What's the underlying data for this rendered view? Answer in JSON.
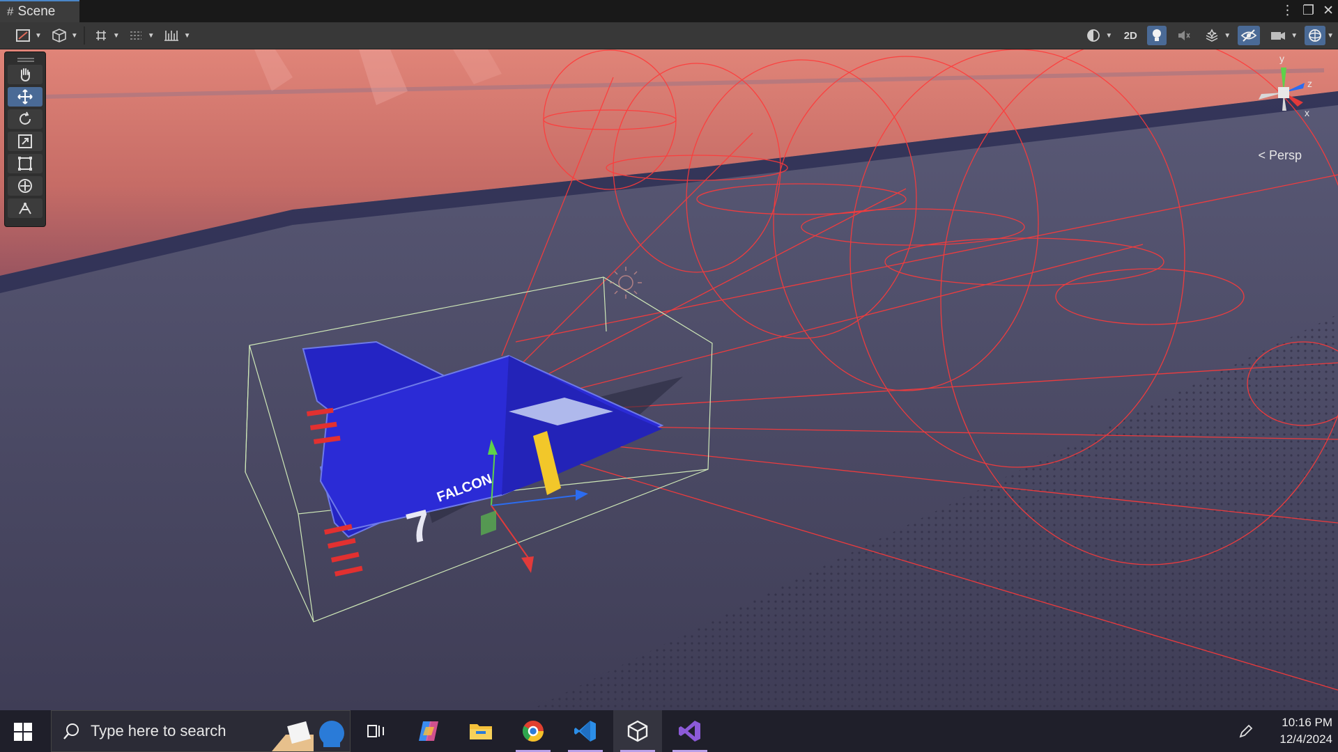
{
  "tab": {
    "title": "Scene",
    "hash": "#"
  },
  "window_controls": [
    "⋮",
    "❐",
    "✕"
  ],
  "toolbar": {
    "two_d_label": "2D",
    "left_tools": [
      "draw-mode-icon",
      "shading-cube-icon",
      "grid-snap-icon",
      "increment-snap-icon",
      "ruler-icon"
    ],
    "right_tools": [
      "render-mode-icon",
      "2d-toggle",
      "lighting-icon",
      "audio-icon",
      "effects-icon",
      "hidden-objects-icon",
      "camera-icon",
      "gizmos-icon"
    ]
  },
  "tools_panel": {
    "items": [
      "hand-tool-icon",
      "move-tool-icon",
      "rotate-tool-icon",
      "scale-tool-icon",
      "rect-tool-icon",
      "transform-tool-icon",
      "custom-tool-icon"
    ],
    "active_index": 1
  },
  "gizmo": {
    "y": "y",
    "z": "z",
    "x": "x",
    "projection": "Persp"
  },
  "ship": {
    "name_text": "FALCON",
    "number": "7"
  },
  "taskbar": {
    "search_placeholder": "Type here to search",
    "apps": [
      "task-view-icon",
      "copilot-icon",
      "file-explorer-icon",
      "chrome-icon",
      "vscode-icon",
      "unity-icon",
      "visual-studio-icon"
    ],
    "time": "10:16 PM",
    "date": "12/4/2024"
  },
  "colors": {
    "accent": "#4a6a96",
    "ship_blue": "#2828c8",
    "gizmo_red": "#e23a3a",
    "gizmo_green": "#5fd14a",
    "gizmo_blue": "#2c6cf0",
    "collider_red": "#ff3a3a",
    "bounds_green": "#cfe8b8"
  }
}
